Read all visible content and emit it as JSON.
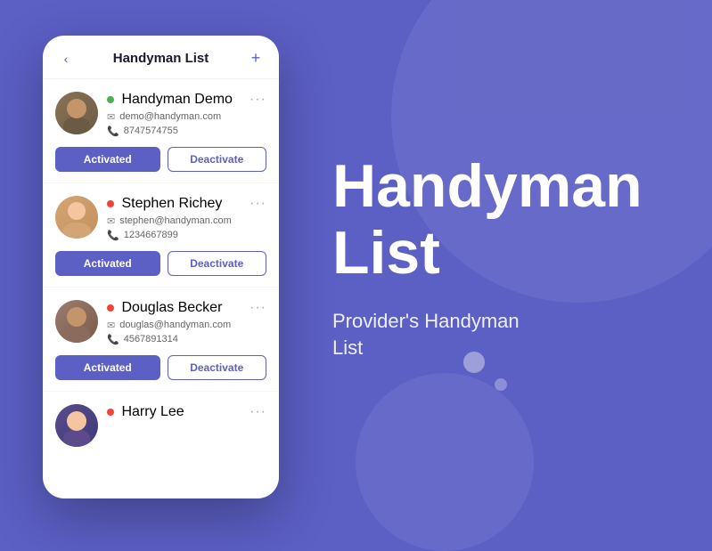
{
  "page": {
    "background_color": "#5c5fc4"
  },
  "header": {
    "title": "Handyman List",
    "back_icon": "‹",
    "add_icon": "+"
  },
  "right_text": {
    "main_title": "Handyman List",
    "subtitle": "Provider's Handyman List"
  },
  "handymen": [
    {
      "id": 1,
      "name": "Handyman Demo",
      "email": "demo@handyman.com",
      "phone": "8747574755",
      "status": "online",
      "avatar_class": "avatar-1",
      "activated_label": "Activated",
      "deactivate_label": "Deactivate"
    },
    {
      "id": 2,
      "name": "Stephen Richey",
      "email": "stephen@handyman.com",
      "phone": "1234667899",
      "status": "offline",
      "avatar_class": "avatar-2",
      "activated_label": "Activated",
      "deactivate_label": "Deactivate"
    },
    {
      "id": 3,
      "name": "Douglas Becker",
      "email": "douglas@handyman.com",
      "phone": "4567891314",
      "status": "offline",
      "avatar_class": "avatar-3",
      "activated_label": "Activated",
      "deactivate_label": "Deactivate"
    },
    {
      "id": 4,
      "name": "Harry Lee",
      "email": "",
      "phone": "",
      "status": "offline",
      "avatar_class": "avatar-4",
      "activated_label": "",
      "deactivate_label": ""
    }
  ],
  "icons": {
    "email": "✉",
    "phone": "📞",
    "more": "···",
    "back": "‹",
    "add": "+"
  }
}
